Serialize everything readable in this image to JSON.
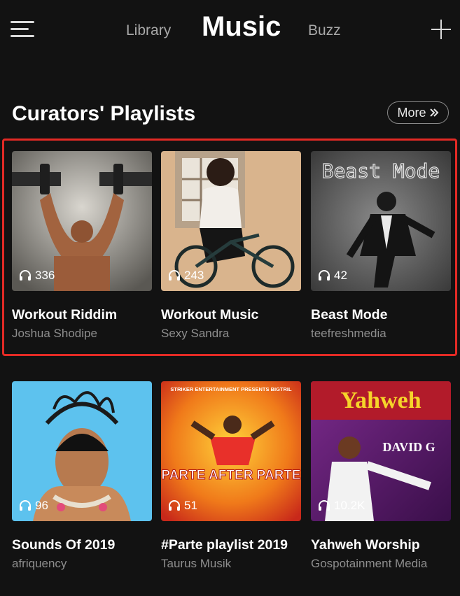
{
  "header": {
    "menu_icon": "menu-icon",
    "tabs": [
      {
        "label": "Library",
        "active": false
      },
      {
        "label": "Music",
        "active": true
      },
      {
        "label": "Buzz",
        "active": false
      }
    ],
    "add_icon": "plus-icon"
  },
  "section": {
    "title": "Curators' Playlists",
    "more_label": "More",
    "more_icon": "double-chevron-right-icon"
  },
  "colors": {
    "background": "#121212",
    "highlight": "#e32a25",
    "muted_text": "#8e8e8e"
  },
  "playlists": [
    {
      "title": "Workout Riddim",
      "curator": "Joshua Shodipe",
      "plays": "336",
      "cover_text": ""
    },
    {
      "title": "Workout Music",
      "curator": "Sexy Sandra",
      "plays": "243",
      "cover_text": ""
    },
    {
      "title": "Beast Mode",
      "curator": "teefreshmedia",
      "plays": "42",
      "cover_text": "Beast Mode"
    },
    {
      "title": "Sounds Of 2019",
      "curator": "afriquency",
      "plays": "96",
      "cover_text": ""
    },
    {
      "title": "#Parte playlist 2019",
      "curator": "Taurus Musik",
      "plays": "51",
      "cover_text": "PARTE AFTER PARTE",
      "cover_subtext": "STRIKER ENTERTAINMENT PRESENTS BIGTRIL"
    },
    {
      "title": "Yahweh Worship",
      "curator": "Gospotainment Media",
      "plays": "10.2K",
      "cover_text": "Yahweh",
      "cover_subtext": "DAVID G"
    }
  ]
}
